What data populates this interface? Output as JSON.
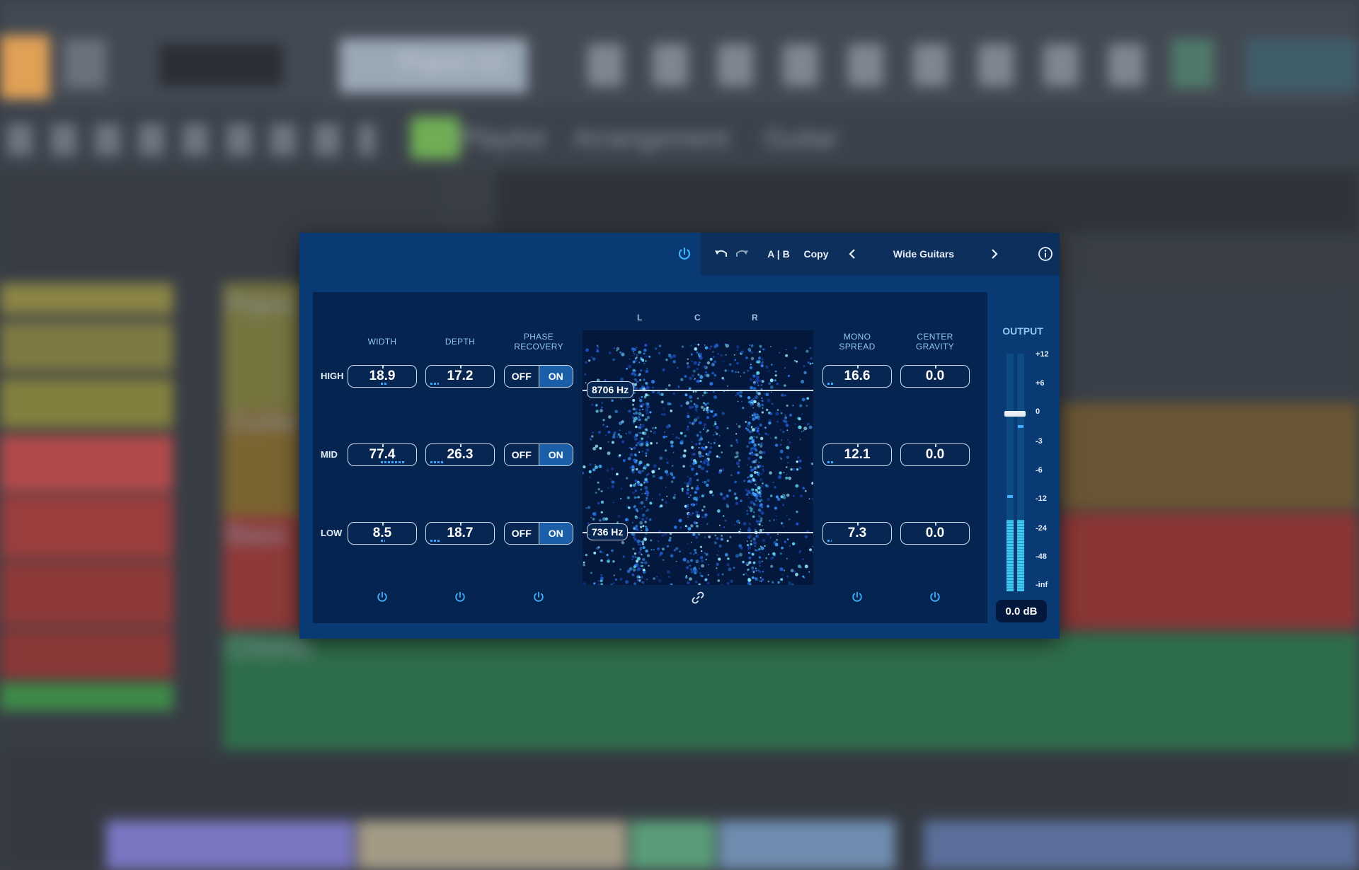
{
  "background": {
    "track_name": "Piano #1",
    "breadcrumb": [
      "Playlist",
      "Arrangement",
      "Guitar"
    ],
    "tracks": [
      "Piano",
      "Guitar",
      "Bass",
      "Chords"
    ]
  },
  "plugin": {
    "toolbar": {
      "ab_label": "A | B",
      "copy_label": "Copy",
      "preset_name": "Wide Guitars"
    },
    "columns": {
      "width": "WIDTH",
      "depth": "DEPTH",
      "phase_recovery_line1": "PHASE",
      "phase_recovery_line2": "RECOVERY",
      "mono_spread_line1": "MONO",
      "mono_spread_line2": "SPREAD",
      "center_gravity_line1": "CENTER",
      "center_gravity_line2": "GRAVITY"
    },
    "bands": [
      {
        "label": "HIGH",
        "width": "18.9",
        "depth": "17.2",
        "phase_off": "OFF",
        "phase_on": "ON",
        "mono_spread": "16.6",
        "center_gravity": "0.0"
      },
      {
        "label": "MID",
        "width": "77.4",
        "depth": "26.3",
        "phase_off": "OFF",
        "phase_on": "ON",
        "mono_spread": "12.1",
        "center_gravity": "0.0"
      },
      {
        "label": "LOW",
        "width": "8.5",
        "depth": "18.7",
        "phase_off": "OFF",
        "phase_on": "ON",
        "mono_spread": "7.3",
        "center_gravity": "0.0"
      }
    ],
    "scope": {
      "left_label": "L",
      "center_label": "C",
      "right_label": "R",
      "high_crossover": "8706 Hz",
      "low_crossover": "736 Hz"
    },
    "output": {
      "label": "OUTPUT",
      "scale": [
        "+12",
        "+6",
        "0",
        "-3",
        "-6",
        "-12",
        "-24",
        "-48",
        "-inf"
      ],
      "readout": "0.0 dB",
      "level_left": 0.3,
      "level_right": 0.3
    },
    "colors": {
      "panel": "#0a3a73",
      "accent": "#39a7ff",
      "meter": "#42c7ee"
    }
  }
}
